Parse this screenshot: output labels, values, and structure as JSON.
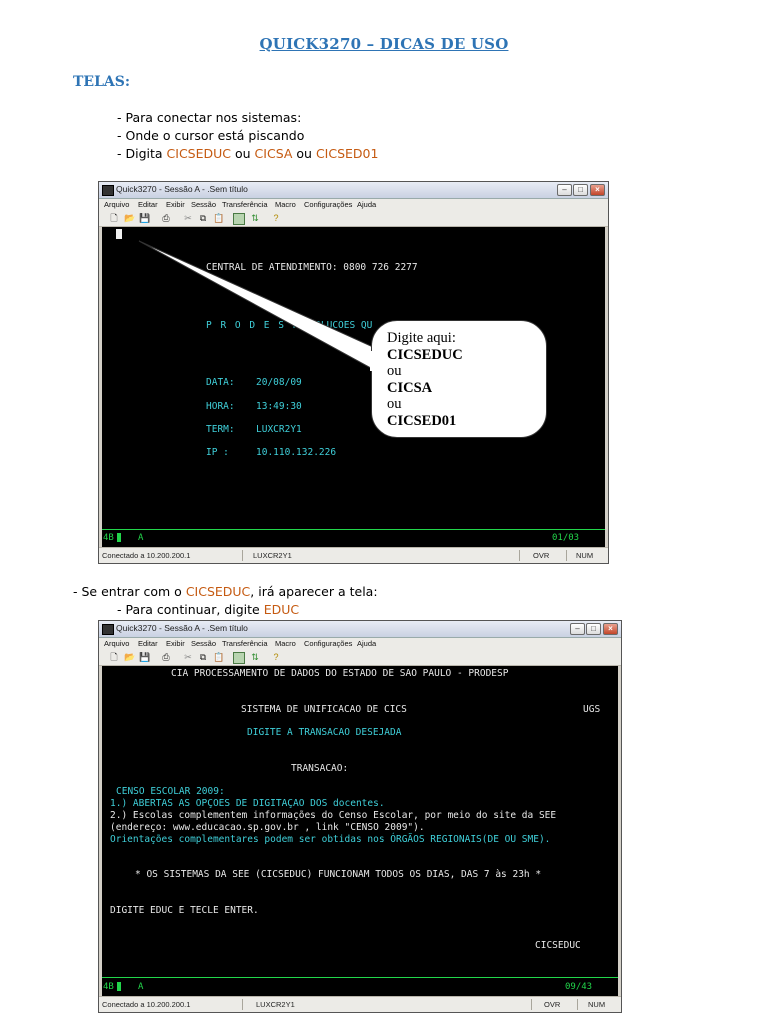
{
  "doc": {
    "title": "QUICK3270 – DICAS DE USO",
    "section": "TELAS:",
    "step1": "- Para conectar nos sistemas:",
    "step2": "- Onde o cursor está piscando",
    "step3_prefix": "- Digita ",
    "step3_opt1": "CICSEDUC",
    "step3_ou1": " ou ",
    "step3_opt2": "CICSA",
    "step3_ou2": " ou ",
    "step3_opt3": "CICSED01",
    "enter_prefix": "- Se entrar com o ",
    "enter_cics": "CICSEDUC",
    "enter_suffix": ", irá aparecer a tela:",
    "continue_prefix": "- Para continuar, digite ",
    "continue_code": "EDUC",
    "highlight_color": "#c55a11",
    "heading_color": "#2e74b5"
  },
  "window": {
    "title": "Quick3270 - Sessão A - .Sem título",
    "menu": [
      "Arquivo",
      "Editar",
      "Exibir",
      "Sessão",
      "Transferência",
      "Macro",
      "Configurações",
      "Ajuda"
    ],
    "toolbar_icons": [
      "new-file-icon",
      "open-folder-icon",
      "save-icon",
      "print-icon",
      "cut-icon",
      "copy-icon",
      "paste-icon",
      "screen-icon",
      "transfer-icon",
      "help-icon"
    ],
    "controls": [
      "minimize-icon",
      "maximize-icon",
      "close-icon"
    ]
  },
  "screen1": {
    "central": "CENTRAL DE ATENDIMENTO: 0800 726 2277",
    "prodesp": "P R O D E S P",
    "prodesp_tail": "- SOLUCOES QU",
    "data_label": "DATA:",
    "data_value": "20/08/09",
    "hora_label": "HORA:",
    "hora_value": "13:49:30",
    "term_label": "TERM:",
    "term_value": "LUXCR2Y1",
    "ip_label": "IP  :",
    "ip_value": "10.110.132.226",
    "oia_left": "4B",
    "oia_mode": "A",
    "oia_right": "01/03",
    "status_connected": "Conectado a 10.200.200.1",
    "status_term": "LUXCR2Y1",
    "status_ovr": "OVR",
    "status_num": "NUM"
  },
  "callout": {
    "line1": "Digite aqui:",
    "line2": "CICSEDUC",
    "line3": "ou",
    "line4": "CICSA",
    "line5": "ou",
    "line6": "CICSED01"
  },
  "screen2": {
    "header": "CIA PROCESSAMENTO DE DADOS DO ESTADO DE SAO PAULO - PRODESP",
    "system": "SISTEMA DE UNIFICACAO DE CICS",
    "ugs": "UGS",
    "prompt": "DIGITE A TRANSACAO DESEJADA",
    "transacao": "TRANSACAO:",
    "censo": "CENSO ESCOLAR 2009:",
    "item1": "1.) ABERTAS AS OPÇOES DE DIGITAÇAO DOS docentes.",
    "item2a": "2.) Escolas complementem informações do Censo Escolar, por meio do site da SEE",
    "item2b": " (endereço: www.educacao.sp.gov.br , link \"CENSO 2009\").",
    "item3": "Orientações complementares podem ser obtidas nos ÓRGÃOS REGIONAIS(DE OU SME).",
    "notice": "* OS SISTEMAS DA SEE (CICSEDUC) FUNCIONAM TODOS OS DIAS, DAS 7 às 23h *",
    "instruction": "DIGITE EDUC E TECLE ENTER.",
    "cics": "CICSEDUC",
    "oia_left": "4B",
    "oia_mode": "A",
    "oia_right": "09/43",
    "status_connected": "Conectado a 10.200.200.1",
    "status_term": "LUXCR2Y1",
    "status_ovr": "OVR",
    "status_num": "NUM"
  }
}
